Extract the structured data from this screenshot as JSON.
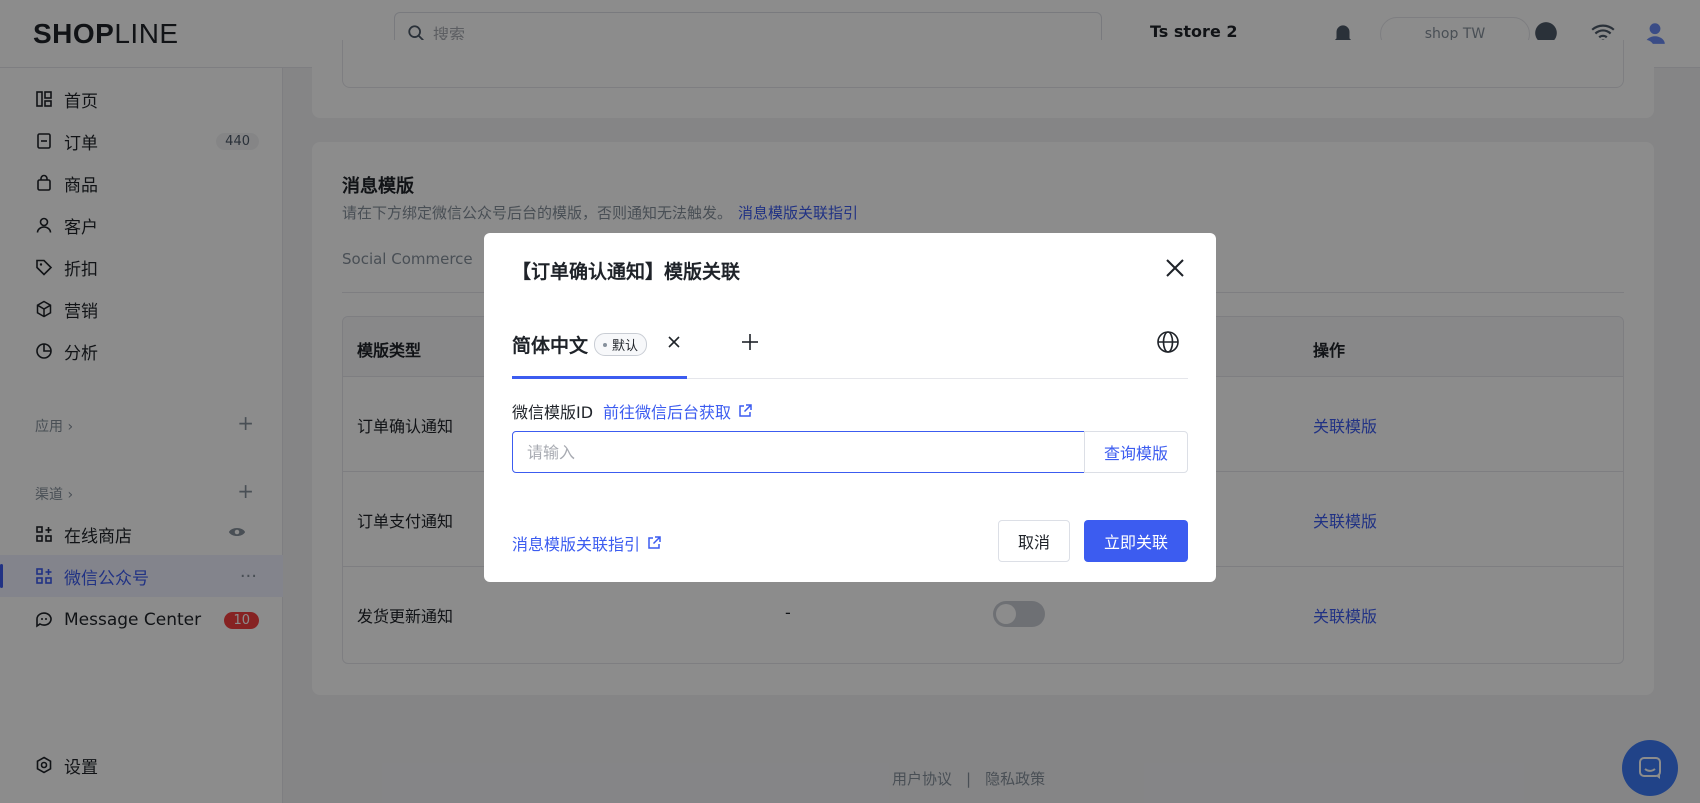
{
  "header": {
    "logo_main": "SHOP",
    "logo_light": "LINE",
    "beta_tag": "",
    "search_placeholder": "搜索",
    "store_name": "Ts store 2",
    "pill_text": "shop TW"
  },
  "sidebar": {
    "items": [
      {
        "label": "首页",
        "icon": "dashboard-icon"
      },
      {
        "label": "订单",
        "icon": "order-icon",
        "badge": "440"
      },
      {
        "label": "商品",
        "icon": "bag-icon"
      },
      {
        "label": "客户",
        "icon": "user-icon"
      },
      {
        "label": "折扣",
        "icon": "tag-icon"
      },
      {
        "label": "营销",
        "icon": "cube-icon"
      },
      {
        "label": "分析",
        "icon": "pie-icon"
      }
    ],
    "apps_label": "应用 ›",
    "channels_label": "渠道 ›",
    "channels": [
      {
        "label": "在线商店",
        "icon": "grid-icon"
      },
      {
        "label": "微信公众号",
        "icon": "grid-icon",
        "active": true
      },
      {
        "label": "Message Center",
        "icon": "chat-icon",
        "badge": "10"
      }
    ],
    "settings_label": "设置"
  },
  "main": {
    "card_title": "消息模版",
    "card_desc": "请在下方绑定微信公众号后台的模版，否则通知无法触发。",
    "card_desc_link": "消息模版关联指引",
    "tab_peek": "Social Commerce",
    "table": {
      "headers": [
        "模版类型",
        "操作"
      ],
      "rows": [
        {
          "type": "订单确认通知",
          "action": "关联模版"
        },
        {
          "type": "订单支付通知",
          "action": "关联模版"
        },
        {
          "type": "发货更新通知",
          "mid": "-",
          "action": "关联模版"
        }
      ]
    }
  },
  "footer": {
    "terms": "用户协议",
    "separator": "|",
    "privacy": "隐私政策"
  },
  "modal": {
    "title": "【订单确认通知】模版关联",
    "lang_tab": "简体中文",
    "lang_default_tag": "默认",
    "field_label": "微信模版ID",
    "field_link": "前往微信后台获取",
    "input_placeholder": "请输入",
    "query_button": "查询模版",
    "guide_link": "消息模版关联指引",
    "cancel_button": "取消",
    "confirm_button": "立即关联"
  }
}
